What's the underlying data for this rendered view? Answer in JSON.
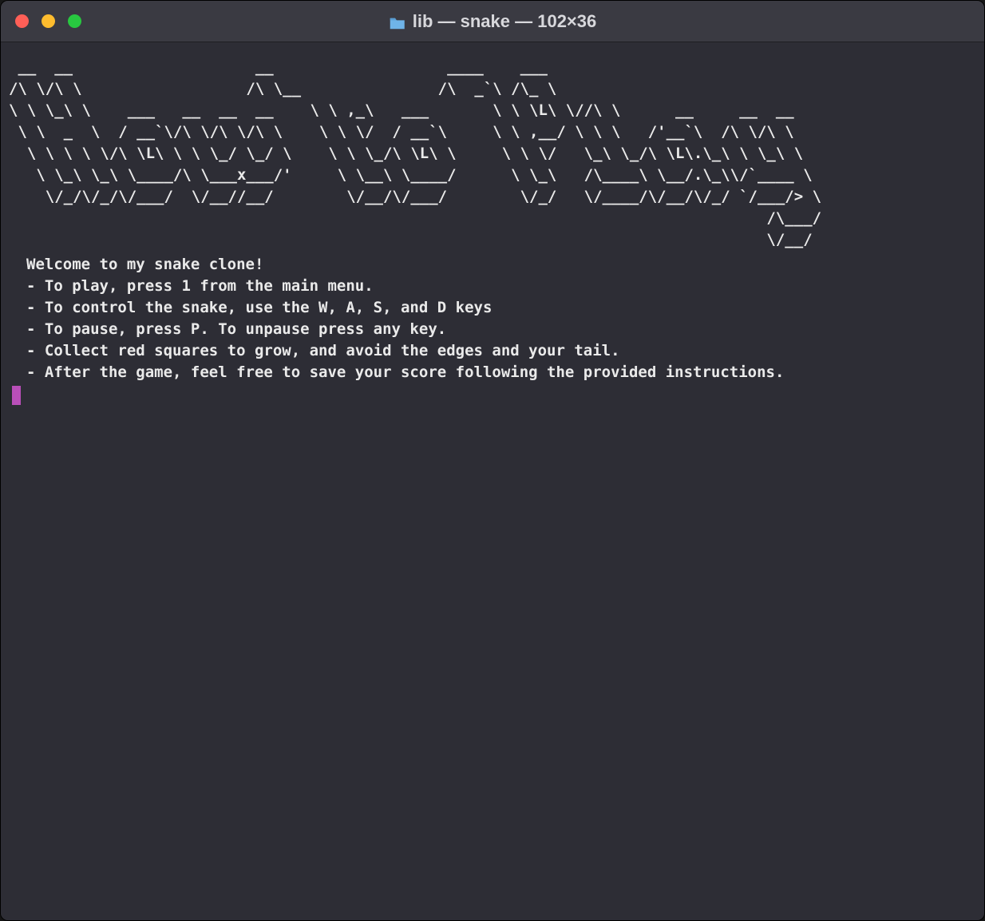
{
  "window": {
    "title": "lib — snake — 102×36"
  },
  "ascii_art": " __  __                    __                   ____    ___\n/\\ \\/\\ \\                  /\\ \\__               /\\  _`\\ /\\_ \\\n\\ \\ \\_\\ \\    ___   __  __  __    \\ \\ ,_\\   ___       \\ \\ \\L\\ \\//\\ \\      __     __  __\n \\ \\  _  \\  / __`\\/\\ \\/\\ \\/\\ \\    \\ \\ \\/  / __`\\     \\ \\ ,__/ \\ \\ \\   /'__`\\  /\\ \\/\\ \\\n  \\ \\ \\ \\ \\/\\ \\L\\ \\ \\ \\_/ \\_/ \\    \\ \\ \\_/\\ \\L\\ \\     \\ \\ \\/   \\_\\ \\_/\\ \\L\\.\\_\\ \\ \\_\\ \\\n   \\ \\_\\ \\_\\ \\____/\\ \\___x___/'     \\ \\__\\ \\____/      \\ \\_\\   /\\____\\ \\__/.\\_\\\\/`____ \\\n    \\/_/\\/_/\\/___/  \\/__//__/        \\/__/\\/___/        \\/_/   \\/____/\\/__/\\/_/ `/___/> \\\n                                                                                   /\\___/\n                                                                                   \\/__/",
  "instructions": {
    "welcome": "Welcome to my snake clone!",
    "lines": [
      "- To play, press 1 from the main menu.",
      "- To control the snake, use the W, A, S, and D keys",
      "- To pause, press P. To unpause press any key.",
      "- Collect red squares to grow, and avoid the edges and your tail.",
      "- After the game, feel free to save your score following the provided instructions."
    ]
  }
}
